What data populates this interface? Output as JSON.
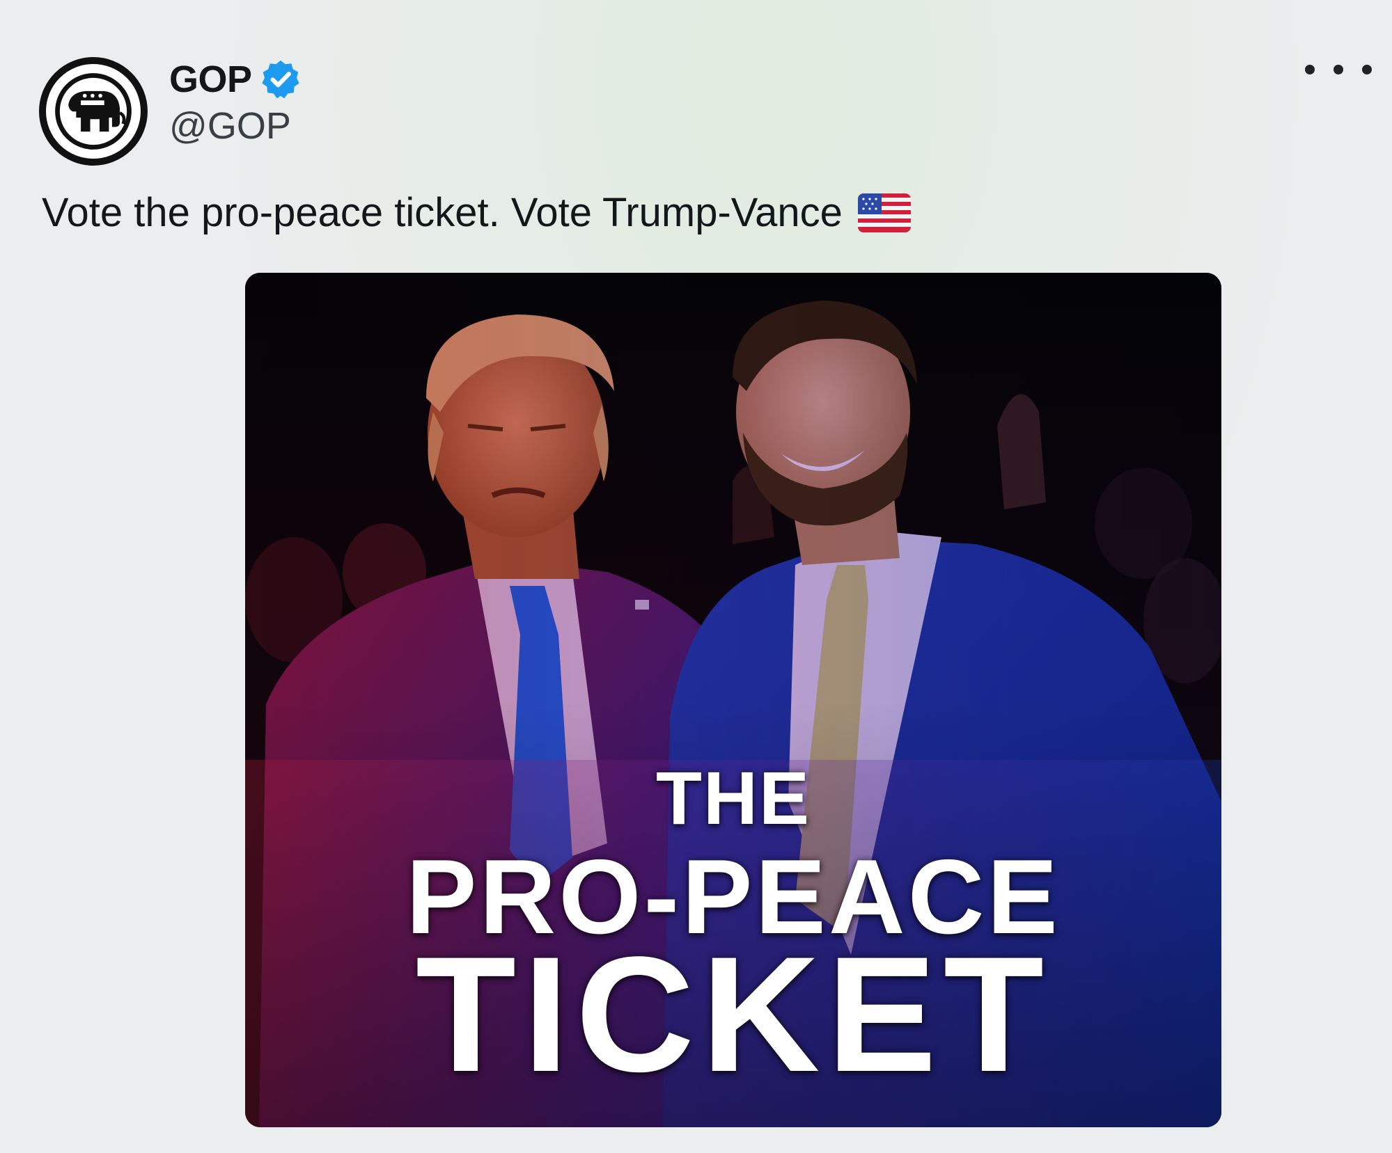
{
  "account": {
    "display_name": "GOP",
    "handle": "@GOP",
    "verified": true,
    "avatar_icon": "gop-elephant-icon"
  },
  "post": {
    "text": "Vote the pro-peace ticket. Vote Trump-Vance",
    "emoji_icon": "us-flag-icon"
  },
  "media": {
    "headline_line1": "THE",
    "headline_line2": "PRO-PEACE",
    "headline_line3": "TICKET"
  },
  "colors": {
    "verified_blue": "#1d9bf0",
    "text_dark": "#14171a",
    "handle_gray": "#3a3f45",
    "suit_blue": "#1f3fa8",
    "gradient_red": "#c01e3c",
    "gradient_blue": "#1b3db8"
  }
}
